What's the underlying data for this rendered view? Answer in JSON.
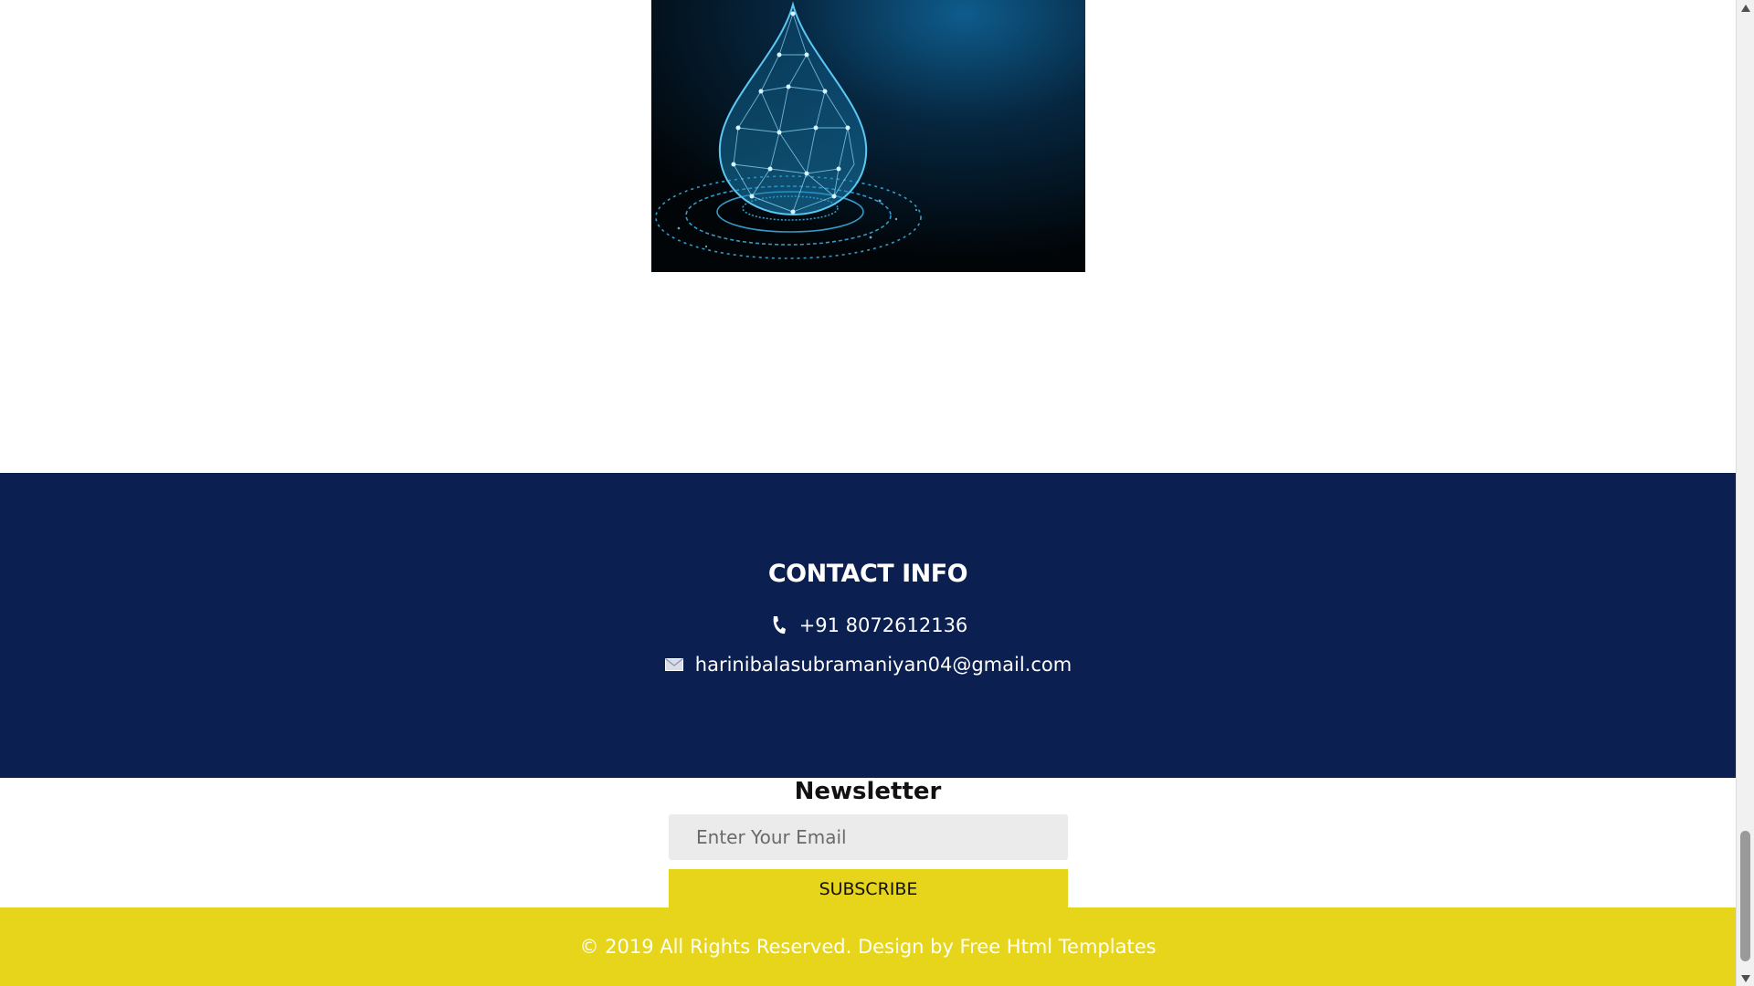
{
  "image": {
    "icon": "water-droplet-network-image"
  },
  "contact": {
    "title": "CONTACT INFO",
    "phone": "+91 8072612136",
    "email": "harinibalasubramaniyan04@gmail.com",
    "phone_icon": "phone-icon",
    "email_icon": "envelope-icon",
    "background_color": "#0b1f51"
  },
  "newsletter": {
    "title": "Newsletter",
    "email_placeholder": "Enter Your Email",
    "subscribe_label": "SUBSCRIBE",
    "button_color": "#e6d51a"
  },
  "footer": {
    "text": "© 2019 All Rights Reserved. Design by Free Html Templates",
    "background_color": "#e6d51a"
  },
  "scrollbar": {
    "position": "bottom"
  }
}
